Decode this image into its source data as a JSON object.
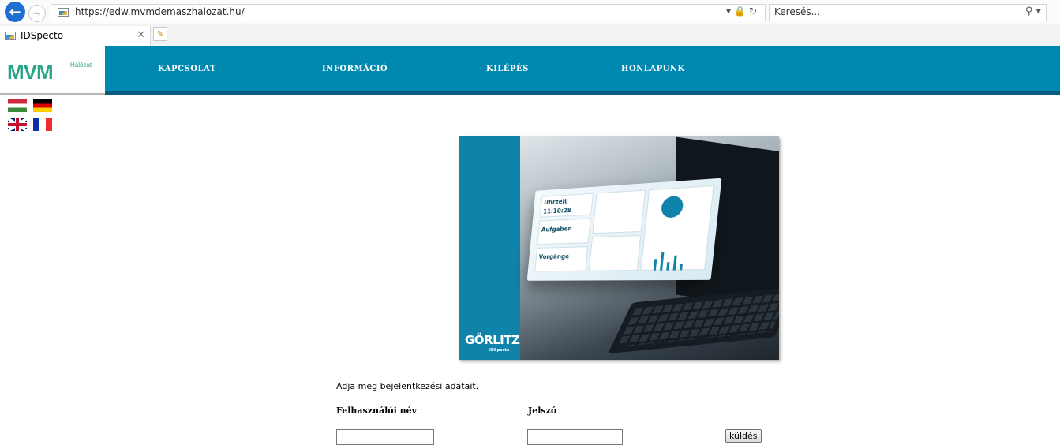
{
  "browser": {
    "url": "https://edw.mvmdemaszhalozat.hu/",
    "search_placeholder": "Keresés...",
    "tab_title": "IDSpecto"
  },
  "site": {
    "logo": "MVM",
    "logo_sub": "Hálózat",
    "nav": [
      "KAPCSOLAT",
      "INFORMÁCIÓ",
      "KILÉPÉS",
      "HONLAPUNK"
    ]
  },
  "hero": {
    "brand": "GÖRLITZ",
    "brand_sub": "IDSpecto",
    "labels": [
      "Uhrzeit",
      "11:10:28",
      "Aufgaben",
      "Vorgänge"
    ]
  },
  "login": {
    "intro": "Adja meg bejelentkezési adatait.",
    "username_label": "Felhasználói név",
    "password_label": "Jelszó",
    "username_value": "",
    "password_value": "",
    "submit_label": "küldés"
  },
  "colors": {
    "brand_green": "#2aa58a",
    "nav_blue": "#0088b0",
    "nav_border": "#045d80",
    "browser_accent": "#1e6fd1"
  }
}
